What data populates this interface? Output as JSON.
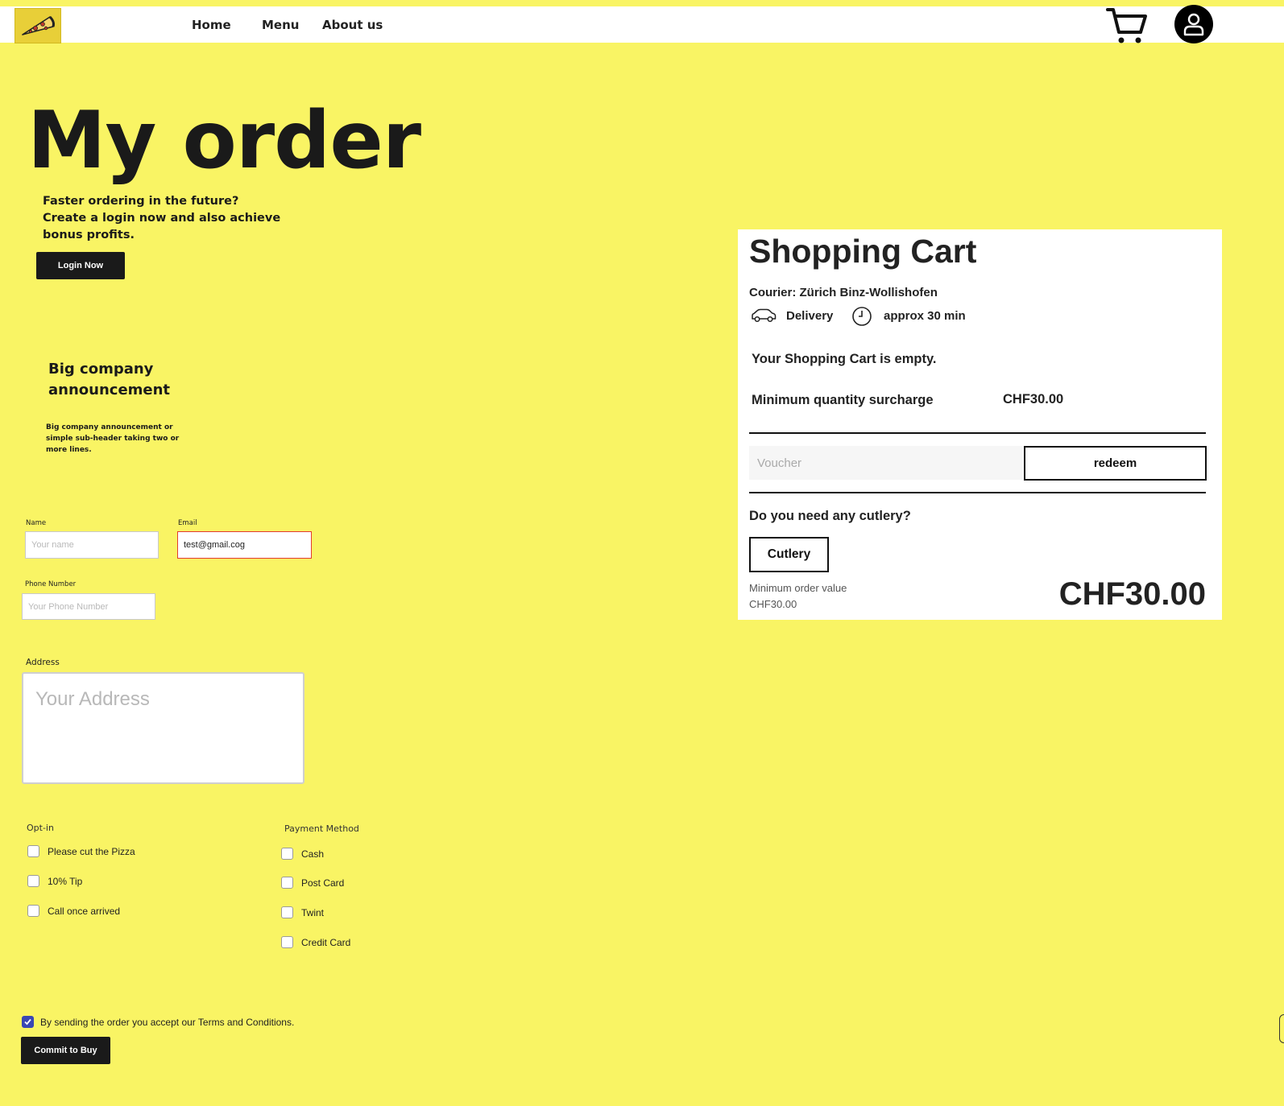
{
  "nav": {
    "logo_icon": "pizza-icon",
    "links": [
      "Home",
      "Menu",
      "About us"
    ],
    "cart_icon": "shopping-cart-icon",
    "user_icon": "user-icon"
  },
  "page": {
    "title": "My order",
    "promo_text": "Faster ordering in the future? Create a login now and also achieve bonus profits.",
    "login_button": "Login Now",
    "announcement_title": "Big company announcement",
    "announcement_sub": "Big company announcement or simple sub-header taking two or more lines."
  },
  "form": {
    "name_label": "Name",
    "name_placeholder": "Your name",
    "email_label": "Email",
    "email_value": "test@gmail.cog",
    "phone_label": "Phone Number",
    "phone_placeholder": "Your Phone Number",
    "address_label": "Address",
    "address_placeholder": "Your Address",
    "optin_label": "Opt-in",
    "optin_options": [
      "Please cut the Pizza",
      "10% Tip",
      "Call once arrived"
    ],
    "payment_label": "Payment Method",
    "payment_options": [
      "Cash",
      "Post Card",
      "Twint",
      "Credit Card"
    ],
    "terms_text": "By sending the order you accept our Terms and Conditions.",
    "terms_checked": true,
    "commit_button": "Commit to Buy"
  },
  "cart": {
    "title": "Shopping Cart",
    "courier": "Courier: Zürich Binz-Wollishofen",
    "delivery_icon": "car-icon",
    "delivery_label": "Delivery",
    "time_icon": "clock-icon",
    "time_label": "approx 30 min",
    "empty_text": "Your Shopping Cart is empty.",
    "surcharge_label": "Minimum quantity surcharge",
    "surcharge_value": "CHF30.00",
    "voucher_placeholder": "Voucher",
    "redeem_button": "redeem",
    "cutlery_question": "Do you need any cutlery?",
    "cutlery_button": "Cutlery",
    "min_order_label": "Minimum order value",
    "min_order_value": "CHF30.00",
    "total": "CHF30.00"
  },
  "colors": {
    "background": "#f9f464",
    "dark_button": "#1a1a1a",
    "invalid_border": "#e13b2f",
    "checkbox_checked": "#3a47b4"
  }
}
